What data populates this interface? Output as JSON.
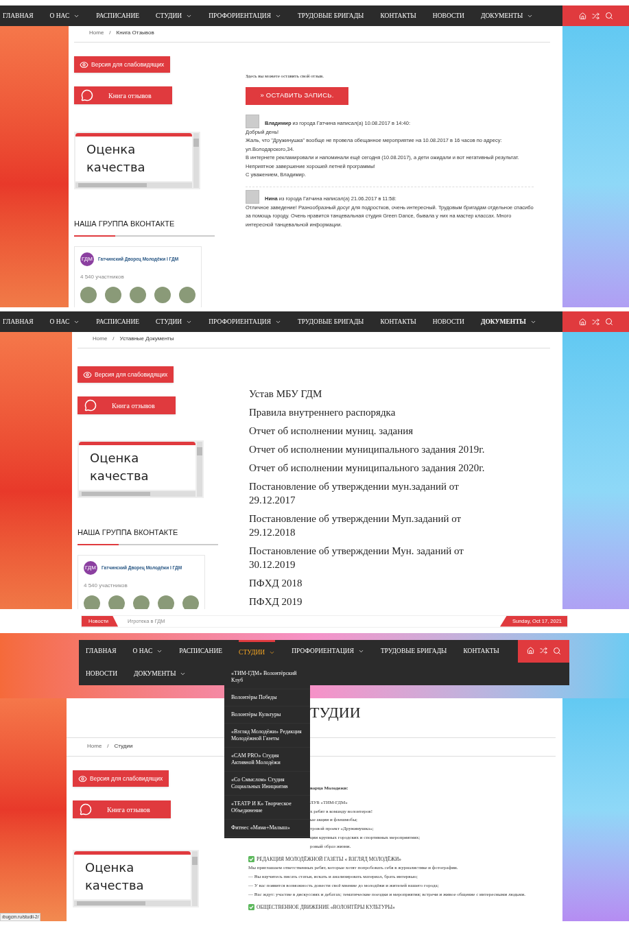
{
  "panels": [
    {
      "kind": "reviews",
      "nav": {
        "rows": [
          [
            {
              "label": "ГЛАВНАЯ",
              "dropdown": false,
              "selected": false
            },
            {
              "label": "О НАС",
              "dropdown": true,
              "selected": false
            },
            {
              "label": "РАСПИСАНИЕ",
              "dropdown": false,
              "selected": false
            },
            {
              "label": "СТУДИИ",
              "dropdown": true,
              "selected": false
            },
            {
              "label": "ПРОФОРИЕНТАЦИЯ",
              "dropdown": true,
              "selected": false
            },
            {
              "label": "ТРУДОВЫЕ БРИГАДЫ",
              "dropdown": false,
              "selected": false
            },
            {
              "label": "КОНТАКТЫ",
              "dropdown": false,
              "selected": false
            },
            {
              "label": "НОВОСТИ",
              "dropdown": false,
              "selected": false
            },
            {
              "label": "ДОКУМЕНТЫ",
              "dropdown": true,
              "selected": false
            }
          ]
        ]
      },
      "breadcrumb": {
        "items": [
          "Home",
          "Книга Отзывов"
        ],
        "separator": "/"
      },
      "sidebar": {
        "buttons": [
          {
            "kind": "eye",
            "label": "Версия для слабовидящих"
          },
          {
            "kind": "chat",
            "label": "Книга отзывов"
          }
        ],
        "quality": "Оценка качества",
        "vk": {
          "heading": "НАША ГРУППА ВКОНТАКТЕ",
          "logo": "ГДМ",
          "group": "Гатчинский Дворец Молодёжи I ГДМ",
          "members": "4 540 участников"
        }
      },
      "intro": "Здесь вы можете оставить свой отзыв.",
      "action": "» ОСТАВИТЬ ЗАПИСЬ.",
      "reviews": [
        {
          "header": "**Владимир** из города Гатчина написал(а) 10.08.2017 в 14:40:",
          "lines": [
            "Добрый день!",
            "Жаль, что \"Дружинушка\" вообще не провела обещанное мероприятие на 10.08.2017 в 16 часов по адресу: ул.Володарского,34.",
            "В интернете рекламировали и напоминали ещё сегодня (10.08.2017), а дети ожидали и вот негативный результат.",
            "Неприятное завершение хорошей летней программы!",
            "С уважением, Владимир."
          ]
        },
        {
          "header": "**Нина** из города Гатчина написал(а) 21.06.2017 в 11:58:",
          "lines": [
            "Отличное заведение! Разнообразный досуг для подростков, очень интересный. Трудовым бригадам отдельное спасибо за помощь городу. Очень нравится танцевальная студия Green Dance, бывала у них на мастер классах. Много интересной танцевальной информации."
          ]
        }
      ]
    },
    {
      "kind": "documents",
      "nav": {
        "rows": [
          [
            {
              "label": "ГЛАВНАЯ",
              "dropdown": false,
              "selected": false
            },
            {
              "label": "О НАС",
              "dropdown": true,
              "selected": false
            },
            {
              "label": "РАСПИСАНИЕ",
              "dropdown": false,
              "selected": false
            },
            {
              "label": "СТУДИИ",
              "dropdown": true,
              "selected": false
            },
            {
              "label": "ПРОФОРИЕНТАЦИЯ",
              "dropdown": true,
              "selected": false
            },
            {
              "label": "ТРУДОВЫЕ БРИГАДЫ",
              "dropdown": false,
              "selected": false
            },
            {
              "label": "КОНТАКТЫ",
              "dropdown": false,
              "selected": false
            },
            {
              "label": "НОВОСТИ",
              "dropdown": false,
              "selected": false
            },
            {
              "label": "ДОКУМЕНТЫ",
              "dropdown": true,
              "selected": true
            }
          ]
        ]
      },
      "breadcrumb": {
        "items": [
          "Home",
          "Уставные Документы"
        ],
        "separator": "/"
      },
      "sidebar": {
        "buttons": [
          {
            "kind": "eye",
            "label": "Версия для слабовидящих"
          },
          {
            "kind": "chat",
            "label": "Книга отзывов"
          }
        ],
        "quality": "Оценка качества",
        "vk": {
          "heading": "НАША ГРУППА ВКОНТАКТЕ",
          "logo": "ГДМ",
          "group": "Гатчинский Дворец Молодёжи I ГДМ",
          "members": "4 540 участников"
        }
      },
      "documents": [
        "Устав МБУ ГДМ",
        "Правила внутреннего распорядка",
        "Отчет об исполнении муниц. задания",
        "Отчет об исполнении муниципального задания 2019г.",
        "Отчет об исполнении муниципального задания 2020г.",
        "Постановление об утверждении мун.заданий от 29.12.2017",
        "Постановление об утверждении Муп.заданий от 29.12.2018",
        "Постановление об утверждении Мун. заданий от 30.12.2019",
        "ПФХД 2018",
        "ПФХД 2019"
      ]
    },
    {
      "kind": "studios",
      "ticker": {
        "label": "Новости",
        "headline": "Игротека в ГДМ",
        "date": "Sunday, Oct 17, 2021"
      },
      "nav": {
        "rows": [
          [
            {
              "label": "ГЛАВНАЯ",
              "dropdown": false,
              "selected": false
            },
            {
              "label": "О НАС",
              "dropdown": true,
              "selected": false
            },
            {
              "label": "РАСПИСАНИЕ",
              "dropdown": false,
              "selected": false
            },
            {
              "label": "СТУДИИ",
              "dropdown": true,
              "selected": true
            },
            {
              "label": "ПРОФОРИЕНТАЦИЯ",
              "dropdown": true,
              "selected": false
            },
            {
              "label": "ТРУДОВЫЕ БРИГАДЫ",
              "dropdown": false,
              "selected": false
            },
            {
              "label": "КОНТАКТЫ",
              "dropdown": false,
              "selected": false
            }
          ],
          [
            {
              "label": "НОВОСТИ",
              "dropdown": false,
              "selected": false
            },
            {
              "label": "ДОКУМЕНТЫ",
              "dropdown": true,
              "selected": false
            }
          ]
        ]
      },
      "dropdown": [
        "«ТИМ-ГДМ» Волонтёрский Клуб",
        "Волонтёры Победы",
        "Волонтёры Культуры",
        "«Взгляд Молодёжи» Редакция Молодёжной Газеты",
        "«САМ PRO» Студия Активной Молодёжи",
        "«Со Смыслом» Студия Социальных Инициатив",
        "«ТЕАТР И К» Творческое Объединение",
        "Фитнес «Мама+Малыш»"
      ],
      "title": "ТУДИИ",
      "breadcrumb": {
        "items": [
          "Home",
          "Студии"
        ],
        "separator": "/"
      },
      "sidebar": {
        "buttons": [
          {
            "kind": "eye",
            "label": "Версия для слабовидящих"
          },
          {
            "kind": "chat",
            "label": "Книга отзывов"
          }
        ],
        "quality": "Оценка качества"
      },
      "covered_lines": [
        "ворца Молодежи:",
        "ЛУБ «ТИМ-ГДМ»",
        "х ребят в команду волонтеров!",
        "ые акции и флешмобы;",
        "тровой проект «Дружинушка»;",
        "ции крупных городских и спортивных мероприятиях;",
        "ровый образ жизни."
      ],
      "sections": [
        {
          "heading": "РЕДАКЦИЯ МОЛОДЁЖНОЙ ГАЗЕТЫ « ВЗГЛЯД МОЛОДЁЖИ»",
          "lines": [
            "Мы приглашаем ответственных ребят, которые хотят попробовать себя в журналистике и фотографии.",
            "— Вы научитесь писать статьи, искать и анализировать материал, брать интервью;",
            "— У вас появится возможность донести своё мнение до молодёжи и жителей нашего города;",
            "— Вас ждут: участие в дискуссиях и дебатах; тематические поездки и мероприятия; встречи и живое общение с интересными людьми."
          ]
        },
        {
          "heading": "ОБЩЕСТВЕННОЕ ДВИЖЕНИЕ «ВОЛОНТЁРЫ КУЛЬТУРЫ»"
        }
      ],
      "status_url": "ıbugcm.ru/studii-2/"
    }
  ]
}
